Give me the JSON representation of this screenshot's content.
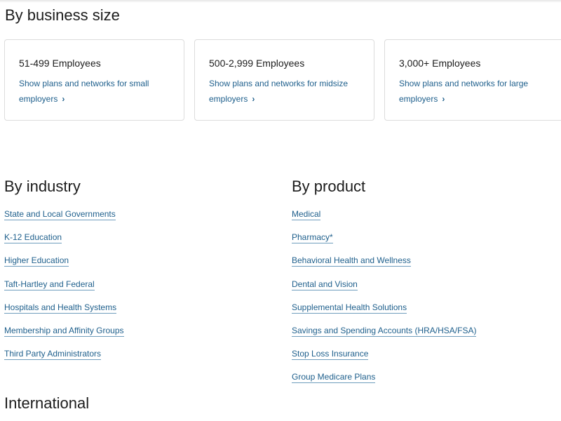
{
  "business_size": {
    "heading": "By business size",
    "cards": [
      {
        "title": "51-499 Employees",
        "link": "Show plans and networks for small employers",
        "chevron": "›"
      },
      {
        "title": "500-2,999 Employees",
        "link": "Show plans and networks for midsize employers",
        "chevron": "›"
      },
      {
        "title": "3,000+ Employees",
        "link": "Show plans and networks for large employers",
        "chevron": "›"
      }
    ]
  },
  "industry": {
    "heading": "By industry",
    "links": [
      "State and Local Governments",
      "K-12 Education",
      "Higher Education",
      "Taft-Hartley and Federal",
      "Hospitals and Health Systems",
      "Membership and Affinity Groups",
      "Third Party Administrators"
    ]
  },
  "product": {
    "heading": "By product",
    "links": [
      "Medical",
      "Pharmacy*",
      "Behavioral Health and Wellness",
      "Dental and Vision",
      "Supplemental Health Solutions",
      "Savings and Spending Accounts (HRA/HSA/FSA)",
      "Stop Loss Insurance",
      "Group Medicare Plans"
    ]
  },
  "international": {
    "heading": "International"
  },
  "colors": {
    "link": "#1e5f8c",
    "heading": "#1c1c1c",
    "card_border": "#dcdcdc"
  },
  "icons": {
    "card_link_chevron": "chevron-right-icon"
  }
}
